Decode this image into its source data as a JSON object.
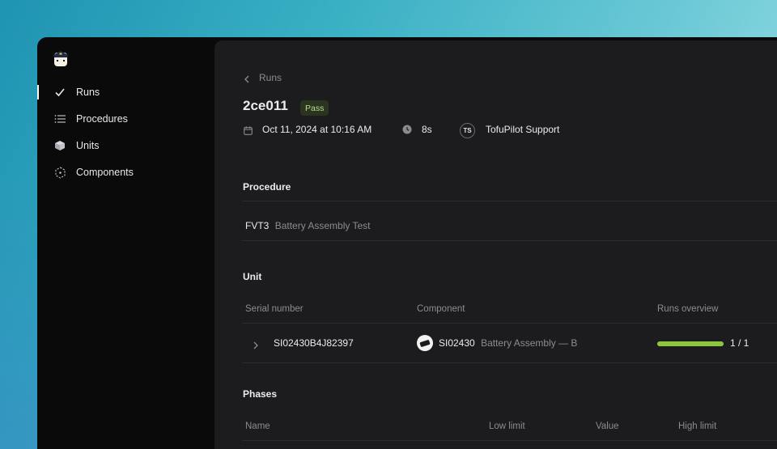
{
  "sidebar": {
    "items": [
      {
        "label": "Runs",
        "icon": "check-icon"
      },
      {
        "label": "Procedures",
        "icon": "list-icon"
      },
      {
        "label": "Units",
        "icon": "cube-icon"
      },
      {
        "label": "Components",
        "icon": "component-icon"
      }
    ],
    "active_index": 0
  },
  "breadcrumb": {
    "label": "Runs"
  },
  "run": {
    "id": "2ce011",
    "status": "Pass",
    "date": "Oct 11, 2024 at 10:16 AM",
    "duration": "8s",
    "operator_initials": "TS",
    "operator": "TofuPilot Support"
  },
  "procedure": {
    "heading": "Procedure",
    "code": "FVT3",
    "name": "Battery Assembly Test"
  },
  "unit": {
    "heading": "Unit",
    "columns": [
      "Serial number",
      "Component",
      "Runs overview"
    ],
    "row": {
      "serial": "SI02430B4J82397",
      "component_code": "SI02430",
      "component_name": "Battery Assembly — B",
      "runs_fraction": 1.0,
      "runs_text": "1 / 1"
    }
  },
  "phases": {
    "heading": "Phases",
    "columns": [
      "Name",
      "Low limit",
      "Value",
      "High limit"
    ]
  },
  "colors": {
    "app_bg": "#0a0a0b",
    "main_bg": "#1c1c1f",
    "pass_bg": "#2a3420",
    "pass_text": "#b8dc8a",
    "progress": "#8cc63f"
  }
}
